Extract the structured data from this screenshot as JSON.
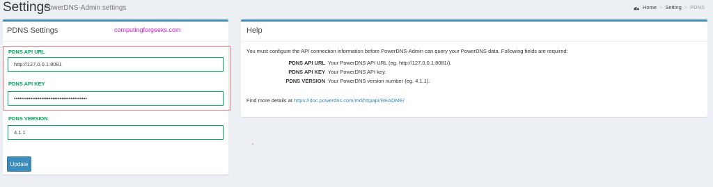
{
  "header": {
    "title": "Settings",
    "subtitle": "PowerDNS-Admin settings",
    "breadcrumb": {
      "home": "Home",
      "setting": "Setting",
      "current": "PDNS",
      "separator": ">"
    }
  },
  "pdns_settings": {
    "title": "PDNS Settings",
    "watermark": "computingforgeeks.com",
    "api_url": {
      "label": "PDNS API URL",
      "value": "http://127.0.0.1:8081"
    },
    "api_key": {
      "label": "PDNS API KEY",
      "value": "••••••••••••••••••••••••••••••••••••••••"
    },
    "version": {
      "label": "PDNS VERSION",
      "value": "4.1.1"
    },
    "update_label": "Update"
  },
  "help": {
    "title": "Help",
    "intro": "You must configure the API connection information before PowerDNS-Admin can query your PowerDNS data. Following fields are required:",
    "items": [
      {
        "term": "PDNS API URL",
        "desc": "Your PowerDNS API URL (eg. http://127.0.0.1:8081/)."
      },
      {
        "term": "PDNS API KEY",
        "desc": "Your PowerDNS API key."
      },
      {
        "term": "PDNS VERSION",
        "desc": "Your PowerDNS version number (eg. 4.1.1)."
      }
    ],
    "more_prefix": "Find more details at ",
    "more_link": "https://doc.powerdns.com/md/httpapi/README/"
  },
  "colors": {
    "accent": "#3c8dbc",
    "label_green": "#00a65a",
    "highlight_red": "#e4797b",
    "watermark": "#d11ccd"
  },
  "icons": {
    "home": "dashboard-icon"
  }
}
